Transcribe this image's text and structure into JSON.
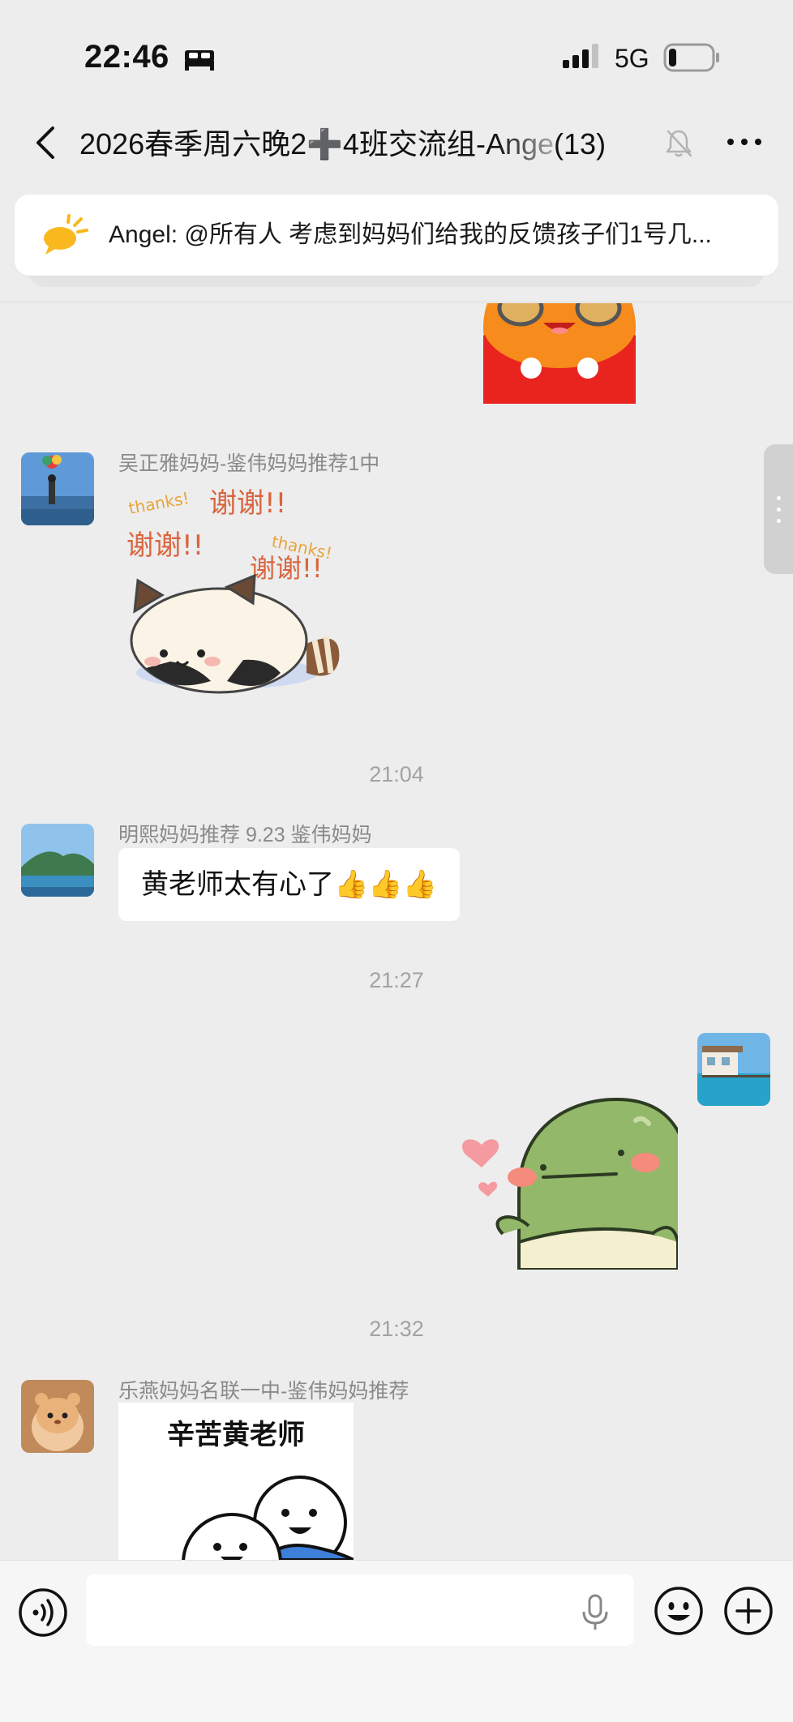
{
  "status_bar": {
    "time": "22:46",
    "network": "5G"
  },
  "nav": {
    "title": "2026春季周六晚2➕4班交流组-Ange",
    "member_count": "(13)"
  },
  "pinned_notice": {
    "text": "Angel: @所有人 考虑到妈妈们给我的反馈孩子们1号几..."
  },
  "messages": [
    {
      "sender": "吴正雅妈妈-鉴伟妈妈推荐1中",
      "sticker_words": [
        "thanks!",
        "谢谢!!",
        "谢谢!!",
        "thanks!",
        "谢谢!!"
      ]
    },
    {
      "timestamp": "21:04"
    },
    {
      "sender": "明熙妈妈推荐 9.23 鉴伟妈妈",
      "text": "黄老师太有心了👍👍👍"
    },
    {
      "timestamp": "21:27"
    },
    {
      "timestamp": "21:32"
    },
    {
      "sender": "乐燕妈妈名联一中-鉴伟妈妈推荐",
      "sticker_caption": "辛苦黄老师"
    }
  ],
  "input": {
    "placeholder": ""
  },
  "colors": {
    "background": "#ededed",
    "bubble": "#ffffff",
    "accent_yellow": "#f8b81e",
    "timestamp": "#a2a2a2"
  }
}
